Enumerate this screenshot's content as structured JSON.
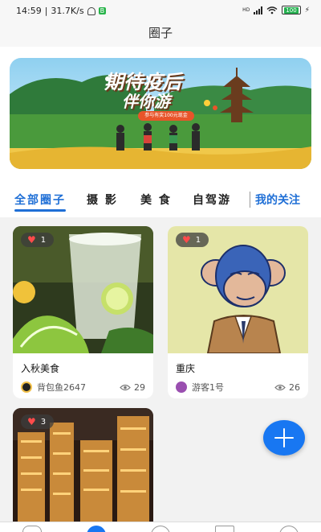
{
  "statusbar": {
    "time": "14:59",
    "network_speed": "31.7K/s",
    "app_badge": "B",
    "signal_label": "HD",
    "battery": "100"
  },
  "header": {
    "title": "圈子"
  },
  "banner": {
    "headline_line1": "期待疫后",
    "headline_line2": "伴你游",
    "ribbon_text": "参与有奖100元现金"
  },
  "tabs": [
    {
      "label": "全部圈子"
    },
    {
      "label": "摄 影"
    },
    {
      "label": "美 食"
    },
    {
      "label": "自驾游"
    },
    {
      "label": "我的关注"
    }
  ],
  "posts": [
    {
      "likes": "1",
      "title": "入秋美食",
      "author": "背包鱼2647",
      "views": "29"
    },
    {
      "likes": "1",
      "title": "重庆",
      "author": "游客1号",
      "views": "26"
    },
    {
      "likes": "3"
    }
  ],
  "colors": {
    "accent": "#1f6fd6",
    "fab": "#1877f2",
    "heart": "#ff4b4b"
  },
  "icons": {
    "fab": "plus-icon",
    "like": "heart-icon",
    "views": "eye-icon"
  }
}
